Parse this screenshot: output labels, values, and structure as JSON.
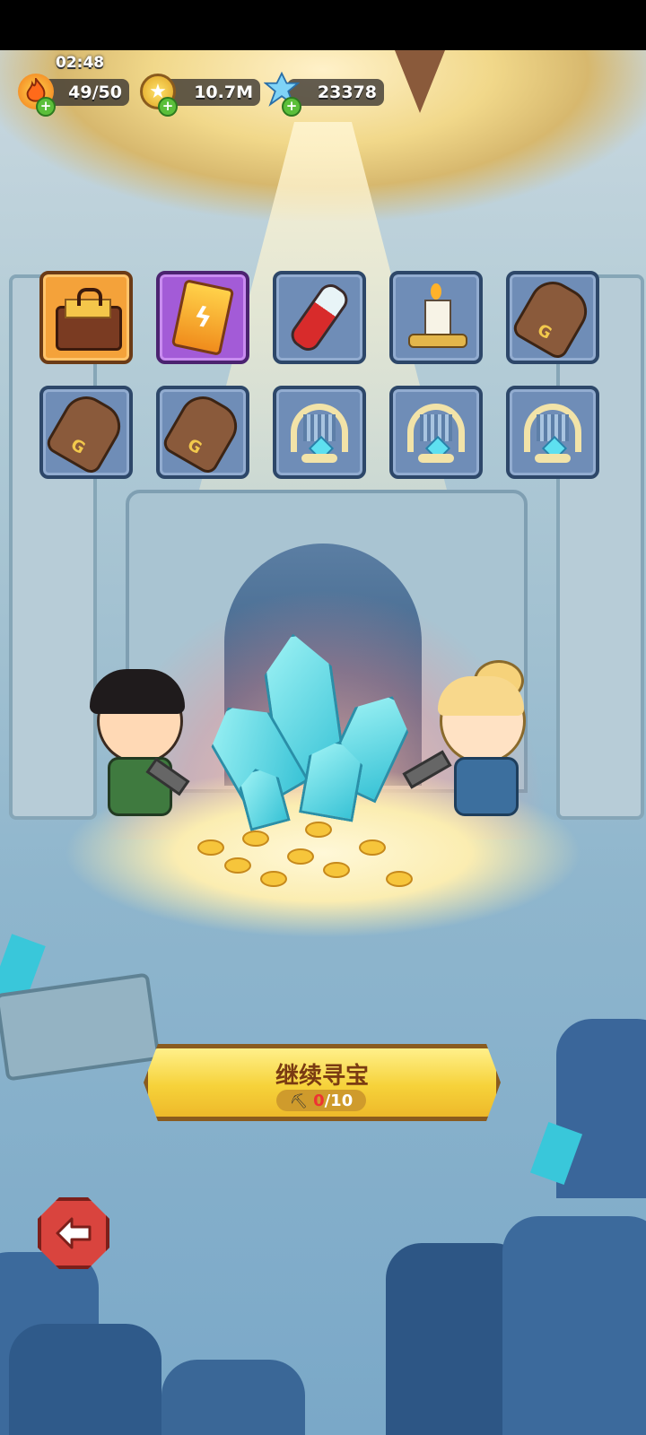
{
  "hud": {
    "timer": "02:48",
    "energy": {
      "value": "49/50",
      "icon": "flame-icon"
    },
    "gold": {
      "value": "10.7M",
      "icon": "gold-coin-icon"
    },
    "gems": {
      "value": "23378",
      "icon": "blue-crystal-icon"
    }
  },
  "items": [
    {
      "name": "treasure-chest-icon",
      "rarity": "orange"
    },
    {
      "name": "lightning-card-icon",
      "rarity": "purple"
    },
    {
      "name": "red-potion-icon",
      "rarity": "blue"
    },
    {
      "name": "candle-icon",
      "rarity": "blue"
    },
    {
      "name": "leather-glove-icon",
      "rarity": "blue"
    },
    {
      "name": "leather-glove-icon",
      "rarity": "blue"
    },
    {
      "name": "leather-glove-icon",
      "rarity": "blue"
    },
    {
      "name": "golden-lyre-icon",
      "rarity": "blue"
    },
    {
      "name": "golden-lyre-icon",
      "rarity": "blue"
    },
    {
      "name": "golden-lyre-icon",
      "rarity": "blue"
    }
  ],
  "continue": {
    "label": "继续寻宝",
    "cost_current": "0",
    "cost_total": "/10",
    "icon": "pickaxe-icon"
  },
  "back": {
    "icon": "back-arrow-icon"
  },
  "colors": {
    "accent": "#f6d23a",
    "slot_blue": "#6f8db7",
    "slot_orange": "#f4a23a",
    "slot_purple": "#a35bd7"
  }
}
